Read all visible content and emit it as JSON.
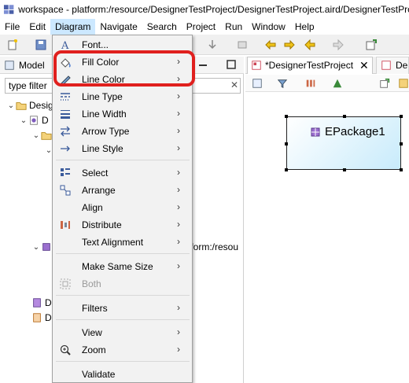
{
  "window": {
    "title": "workspace - platform:/resource/DesignerTestProject/DesignerTestProject.aird/DesignerTestProject"
  },
  "menubar": {
    "items": [
      {
        "label": "File"
      },
      {
        "label": "Edit"
      },
      {
        "label": "Diagram"
      },
      {
        "label": "Navigate"
      },
      {
        "label": "Search"
      },
      {
        "label": "Project"
      },
      {
        "label": "Run"
      },
      {
        "label": "Window"
      },
      {
        "label": "Help"
      }
    ]
  },
  "left_view": {
    "tab_label": "Model",
    "filter_placeholder": "type filter",
    "tree": [
      {
        "label": "Desig",
        "indent": 0,
        "expanded": true
      },
      {
        "label": "D",
        "indent": 1,
        "expanded": true
      },
      {
        "label": "",
        "indent": 2,
        "expanded": true
      },
      {
        "label": "",
        "indent": 2,
        "expanded": true
      },
      {
        "label": "tform:/resou",
        "indent": 2
      },
      {
        "label": "D",
        "indent": 1
      },
      {
        "label": "D",
        "indent": 1
      }
    ]
  },
  "editor": {
    "tab_label": "*DesignerTestProject",
    "tab2_label": "De",
    "node_label": "EPackage1"
  },
  "context_menu": {
    "items": [
      {
        "label": "Font...",
        "icon": "font-icon"
      },
      {
        "label": "Fill Color",
        "icon": "paint-bucket-icon",
        "submenu": true
      },
      {
        "label": "Line Color",
        "icon": "pen-icon",
        "submenu": true
      },
      {
        "label": "Line Type",
        "icon": "line-type-icon",
        "submenu": true
      },
      {
        "label": "Line Width",
        "icon": "line-width-icon",
        "submenu": true
      },
      {
        "label": "Arrow Type",
        "icon": "arrow-type-icon",
        "submenu": true
      },
      {
        "label": "Line Style",
        "icon": "line-style-icon",
        "submenu": true
      },
      {
        "label": "Select",
        "icon": "select-icon",
        "submenu": true
      },
      {
        "label": "Arrange",
        "icon": "arrange-icon",
        "submenu": true
      },
      {
        "label": "Align",
        "icon": "align-icon",
        "submenu": true
      },
      {
        "label": "Distribute",
        "icon": "distribute-icon",
        "submenu": true
      },
      {
        "label": "Text Alignment",
        "submenu": true
      },
      {
        "label": "Make Same Size",
        "submenu": true
      },
      {
        "label": "Both",
        "icon": "same-size-icon",
        "disabled": true
      },
      {
        "label": "Filters",
        "submenu": true
      },
      {
        "label": "View",
        "submenu": true
      },
      {
        "label": "Zoom",
        "icon": "zoom-icon",
        "submenu": true
      },
      {
        "label": "Validate"
      }
    ]
  },
  "colors": {
    "highlight_ring": "#e0201e",
    "menu_hover": "#cce8ff",
    "node_fill": "#c8ebfb"
  }
}
